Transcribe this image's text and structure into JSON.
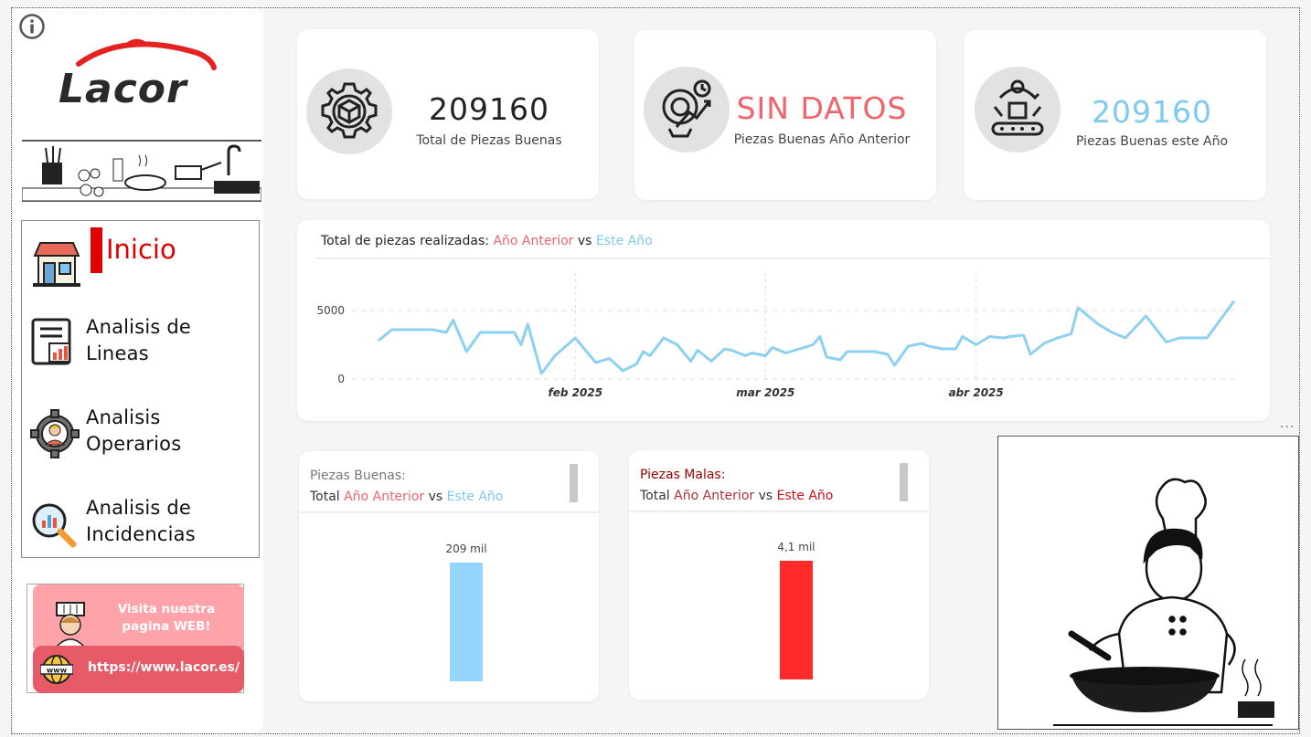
{
  "brand": {
    "name": "Lacor"
  },
  "nav": {
    "items": [
      {
        "label": "Inicio",
        "active": true
      },
      {
        "label": "Analisis de\nLineas"
      },
      {
        "label": "Analisis\nOperarios"
      },
      {
        "label": "Analisis de\nIncidencias"
      }
    ]
  },
  "web": {
    "cta": "Visita nuestra pagina WEB!",
    "url": "https://www.lacor.es/",
    "globe_text": "www"
  },
  "kpis": [
    {
      "value": "209160",
      "label": "Total de Piezas Buenas",
      "color": "#222222"
    },
    {
      "value": "SIN DATOS",
      "label": "Piezas Buenas Año Anterior",
      "color": "#f0646c"
    },
    {
      "value": "209160",
      "label": "Piezas Buenas este Año",
      "color": "#7ec9ef"
    }
  ],
  "line_chart": {
    "title_prefix": "Total de piezas realizadas:",
    "title_a": "Año Anterior",
    "title_vs": "vs",
    "title_b": "Este Año",
    "ellipsis": "..."
  },
  "bar_chart_1": {
    "line1": "Piezas Buenas:",
    "prefix": "Total",
    "a": "Año Anterior",
    "vs": "vs",
    "b": "Este Año",
    "value_label": "209 mil"
  },
  "bar_chart_2": {
    "line1": "Piezas Malas:",
    "prefix": "Total",
    "a": "Año Anterior",
    "vs": "vs",
    "b": "Este Año",
    "value_label": "4,1 mil"
  },
  "chart_data": [
    {
      "type": "line",
      "title": "Total de piezas realizadas: Año Anterior vs Este Año",
      "y_ticks": [
        "0",
        "5000"
      ],
      "ylim": [
        0,
        6500
      ],
      "x_ticks": [
        "feb 2025",
        "mar 2025",
        "abr 2025"
      ],
      "x_tick_days": [
        31,
        59,
        90
      ],
      "xlim": [
        0,
        128
      ],
      "grid": true,
      "series": [
        {
          "name": "Este Año",
          "color": "#8dd1f2",
          "x": [
            2,
            4,
            7,
            10,
            12,
            13,
            15,
            17,
            20,
            22,
            23,
            24,
            26,
            28,
            31,
            34,
            36,
            38,
            40,
            41,
            42,
            44,
            46,
            48,
            49,
            51,
            53,
            54,
            56,
            57,
            59,
            60,
            62,
            64,
            66,
            67,
            68,
            70,
            71,
            73,
            75,
            77,
            78,
            80,
            82,
            83,
            85,
            87,
            88,
            90,
            92,
            94,
            95,
            97,
            98,
            100,
            102,
            104,
            105,
            108,
            110,
            112,
            115,
            118,
            120,
            124,
            128
          ],
          "y": [
            2800,
            3600,
            3600,
            3600,
            3400,
            4300,
            2000,
            3400,
            3400,
            3400,
            2500,
            4000,
            400,
            1700,
            3000,
            1200,
            1500,
            600,
            1100,
            2000,
            1700,
            3000,
            2500,
            1300,
            2100,
            1300,
            2200,
            2100,
            1700,
            1900,
            1700,
            2300,
            1900,
            2200,
            2500,
            3100,
            1600,
            1400,
            2000,
            2000,
            2000,
            1800,
            1000,
            2400,
            2600,
            2400,
            2200,
            2200,
            3100,
            2500,
            3100,
            3000,
            3100,
            3200,
            1800,
            2600,
            3000,
            3300,
            5200,
            4000,
            3400,
            3000,
            4600,
            2700,
            3000,
            3000,
            5700
          ]
        }
      ]
    },
    {
      "type": "bar",
      "title": "Piezas Buenas: Total Año Anterior vs Este Año",
      "categories": [
        "Este Año"
      ],
      "values": [
        209160
      ],
      "data_labels": [
        "209 mil"
      ],
      "color": "#94d6fb"
    },
    {
      "type": "bar",
      "title": "Piezas Malas: Total Año Anterior vs Este Año",
      "categories": [
        "Este Año"
      ],
      "values": [
        4100
      ],
      "data_labels": [
        "4,1 mil"
      ],
      "color": "#ff2a2a"
    }
  ]
}
